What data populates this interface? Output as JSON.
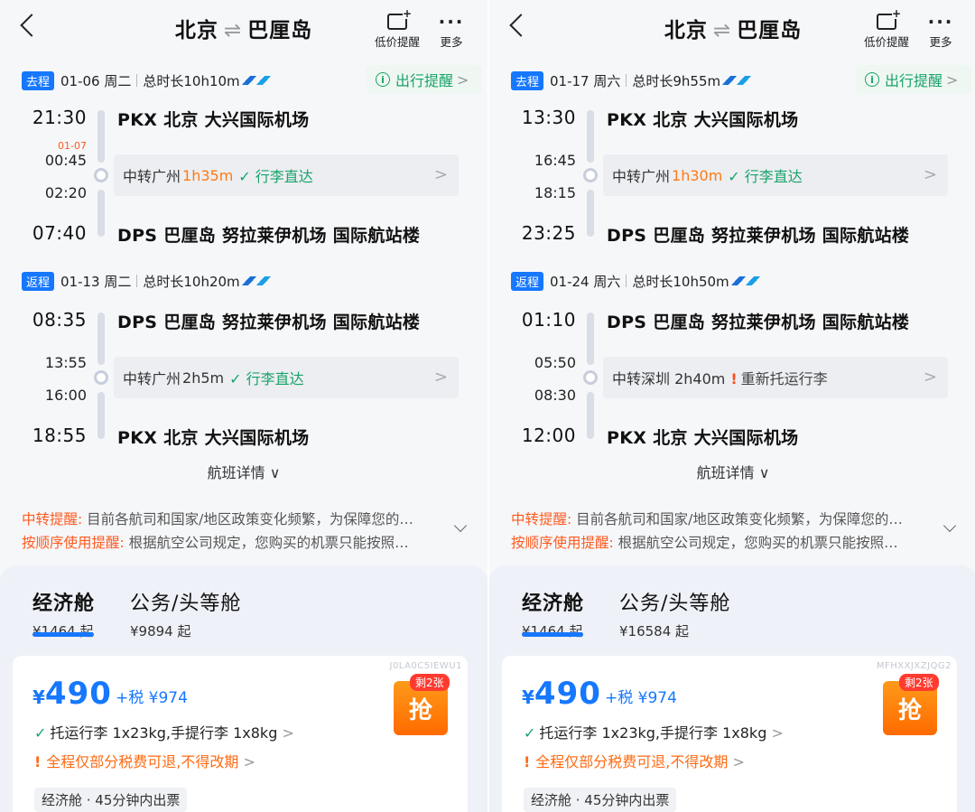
{
  "panels": [
    {
      "header": {
        "from": "北京",
        "eq": "⇌",
        "to": "巴厘岛",
        "price_alert": "低价提醒",
        "more": "更多"
      },
      "outbound": {
        "tag": "去程",
        "date": "01-06 周二",
        "duration": "总时长10h10m",
        "reminder": "出行提醒",
        "dep_time": "21:30",
        "dep_airport": "PKX  北京 大兴国际机场",
        "next_day": "01-07",
        "arr_stop": "00:45",
        "dep_stop": "02:20",
        "stop_prefix": "中转广州",
        "stop_dur": "1h35m",
        "stop_note": "✓ 行李直达",
        "stop_type": "ok",
        "arr_time": "07:40",
        "arr_airport": "DPS  巴厘岛 努拉莱伊机场 国际航站楼"
      },
      "return": {
        "tag": "返程",
        "date": "01-13 周二",
        "duration": "总时长10h20m",
        "dep_time": "08:35",
        "dep_airport": "DPS  巴厘岛 努拉莱伊机场 国际航站楼",
        "arr_stop": "13:55",
        "dep_stop": "16:00",
        "stop_prefix": "中转广州",
        "stop_dur": "2h5m",
        "stop_note": "✓ 行李直达",
        "stop_type": "ok",
        "arr_time": "18:55",
        "arr_airport": "PKX  北京 大兴国际机场"
      },
      "details": "航班详情",
      "notice1_label": "中转提醒:",
      "notice1_text": " 目前各航司和国家/地区政策变化频繁，为保障您的…",
      "notice2_label": "按顺序使用提醒:",
      "notice2_text": " 根据航空公司规定，您购买的机票只能按照…",
      "cabin_econ": "经济舱",
      "cabin_econ_price": "¥1464 起",
      "cabin_biz": "公务/头等舱",
      "cabin_biz_price": "¥9894 起",
      "offer": {
        "code": "J0LA0C5IEWU1",
        "yen": "¥",
        "price": "490",
        "tax": "+税 ¥974",
        "baggage": "托运行李 1x23kg,手提行李 1x8kg",
        "refund": "全程仅部分税费可退,不得改期",
        "chip": "经济舱 · 45分钟内出票",
        "remain": "剩2张",
        "grab": "抢"
      }
    },
    {
      "header": {
        "from": "北京",
        "eq": "⇌",
        "to": "巴厘岛",
        "price_alert": "低价提醒",
        "more": "更多"
      },
      "outbound": {
        "tag": "去程",
        "date": "01-17 周六",
        "duration": "总时长9h55m",
        "reminder": "出行提醒",
        "dep_time": "13:30",
        "dep_airport": "PKX  北京 大兴国际机场",
        "next_day": "",
        "arr_stop": "16:45",
        "dep_stop": "18:15",
        "stop_prefix": "中转广州",
        "stop_dur": "1h30m",
        "stop_note": "✓ 行李直达",
        "stop_type": "ok",
        "arr_time": "23:25",
        "arr_airport": "DPS  巴厘岛 努拉莱伊机场 国际航站楼"
      },
      "return": {
        "tag": "返程",
        "date": "01-24 周六",
        "duration": "总时长10h50m",
        "dep_time": "01:10",
        "dep_airport": "DPS  巴厘岛 努拉莱伊机场 国际航站楼",
        "arr_stop": "05:50",
        "dep_stop": "08:30",
        "stop_prefix": "中转深圳 2h40m",
        "stop_dur": "",
        "stop_note": "重新托运行李",
        "stop_type": "warn",
        "arr_time": "12:00",
        "arr_airport": "PKX  北京 大兴国际机场"
      },
      "details": "航班详情",
      "notice1_label": "中转提醒:",
      "notice1_text": " 目前各航司和国家/地区政策变化频繁，为保障您的…",
      "notice2_label": "按顺序使用提醒:",
      "notice2_text": " 根据航空公司规定，您购买的机票只能按照…",
      "cabin_econ": "经济舱",
      "cabin_econ_price": "¥1464 起",
      "cabin_biz": "公务/头等舱",
      "cabin_biz_price": "¥16584 起",
      "offer": {
        "code": "MFHXXJXZJQG2",
        "yen": "¥",
        "price": "490",
        "tax": "+税 ¥974",
        "baggage": "托运行李 1x23kg,手提行李 1x8kg",
        "refund": "全程仅部分税费可退,不得改期",
        "chip": "经济舱 · 45分钟内出票",
        "remain": "剩2张",
        "grab": "抢"
      }
    }
  ],
  "colors": {
    "accent": "#1677ff",
    "green": "#1aa36a",
    "orange": "#ff7a12",
    "red": "#ff3b30"
  }
}
